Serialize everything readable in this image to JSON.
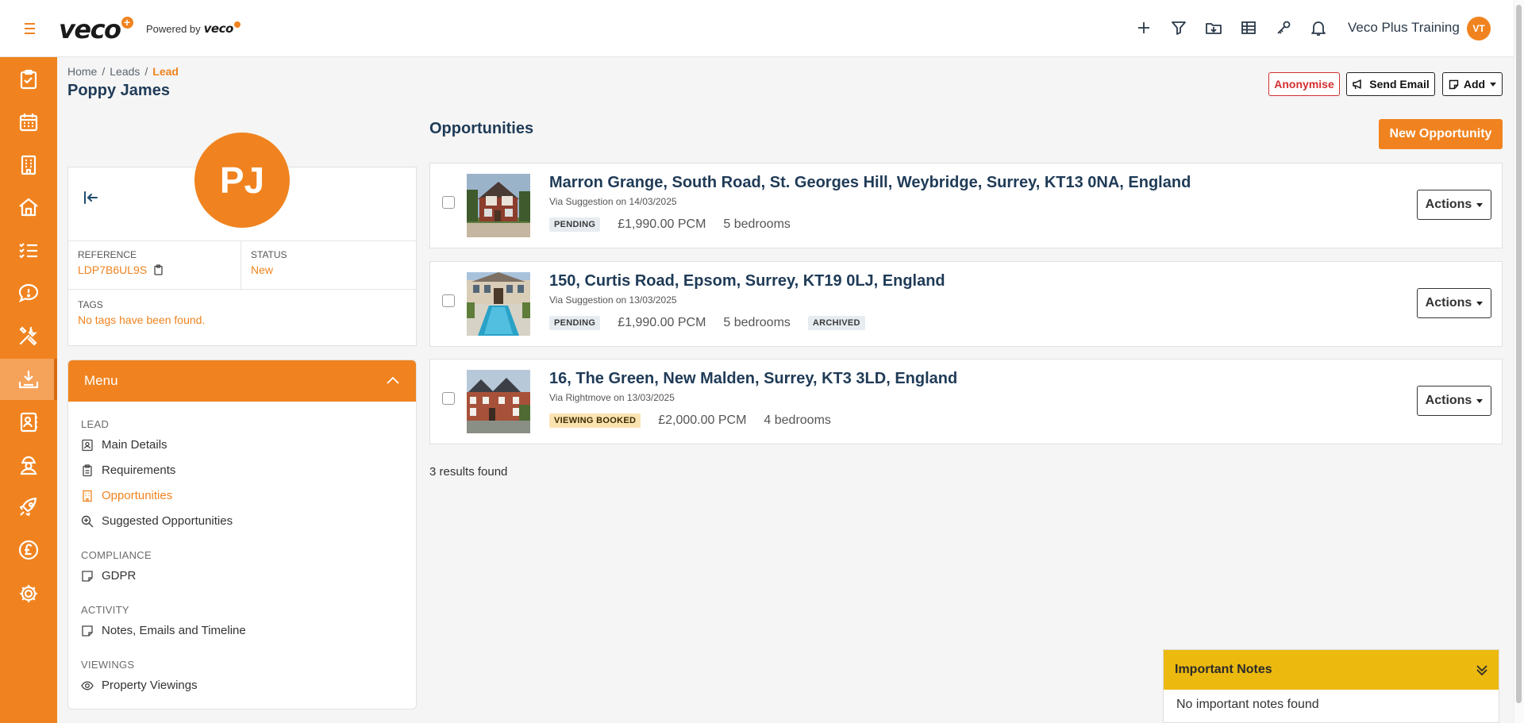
{
  "header": {
    "logo": "veco",
    "powered_by": "Powered by",
    "powered_logo": "veco",
    "user_name": "Veco Plus Training",
    "user_initials": "VT",
    "icons": [
      "plus-icon",
      "filter-icon",
      "folder-download-icon",
      "table-icon",
      "key-icon",
      "bell-icon"
    ]
  },
  "sidebar": {
    "items": [
      {
        "name": "tasks-icon"
      },
      {
        "name": "calendar-icon"
      },
      {
        "name": "building-icon"
      },
      {
        "name": "home-icon"
      },
      {
        "name": "checklist-icon"
      },
      {
        "name": "alert-bubble-icon"
      },
      {
        "name": "tools-icon"
      },
      {
        "name": "download-tray-icon",
        "active": true
      },
      {
        "name": "contacts-icon"
      },
      {
        "name": "worker-icon"
      },
      {
        "name": "rocket-icon"
      },
      {
        "name": "pound-icon"
      },
      {
        "name": "gear-icon"
      }
    ]
  },
  "breadcrumb": {
    "home": "Home",
    "sep1": "/",
    "leads": "Leads",
    "sep2": "/",
    "current": "Lead"
  },
  "page_title": "Poppy James",
  "actions": {
    "anonymise": "Anonymise",
    "send_email": "Send Email",
    "add": "Add"
  },
  "profile": {
    "initials": "PJ",
    "reference_label": "REFERENCE",
    "reference_value": "LDP7B6UL9S",
    "status_label": "STATUS",
    "status_value": "New",
    "tags_label": "TAGS",
    "tags_value": "No tags have been found."
  },
  "menu": {
    "title": "Menu",
    "sections": {
      "lead": "LEAD",
      "compliance": "COMPLIANCE",
      "activity": "ACTIVITY",
      "viewings": "VIEWINGS"
    },
    "links": {
      "main_details": "Main Details",
      "requirements": "Requirements",
      "opportunities": "Opportunities",
      "suggested": "Suggested Opportunities",
      "gdpr": "GDPR",
      "notes": "Notes, Emails and Timeline",
      "property_viewings": "Property Viewings"
    }
  },
  "opportunities": {
    "title": "Opportunities",
    "new_button": "New Opportunity",
    "actions_label": "Actions",
    "items": [
      {
        "address": "Marron Grange, South Road, St. Georges Hill, Weybridge, Surrey, KT13 0NA, England",
        "via": "Via Suggestion on 14/03/2025",
        "status": "PENDING",
        "price": "£1,990.00 PCM",
        "bedrooms": "5 bedrooms",
        "extra_badge": ""
      },
      {
        "address": "150, Curtis Road, Epsom, Surrey, KT19 0LJ, England",
        "via": "Via Suggestion on 13/03/2025",
        "status": "PENDING",
        "price": "£1,990.00 PCM",
        "bedrooms": "5 bedrooms",
        "extra_badge": "ARCHIVED"
      },
      {
        "address": "16, The Green, New Malden, Surrey, KT3 3LD, England",
        "via": "Via Rightmove on 13/03/2025",
        "status": "VIEWING BOOKED",
        "price": "£2,000.00 PCM",
        "bedrooms": "4 bedrooms",
        "extra_badge": ""
      }
    ],
    "results": "3 results found"
  },
  "important_notes": {
    "title": "Important Notes",
    "body": "No important notes found"
  },
  "colors": {
    "brand_orange": "#f0831f",
    "navy": "#1f3b57",
    "notes_yellow": "#ecb90f",
    "danger": "#d32f2f"
  }
}
